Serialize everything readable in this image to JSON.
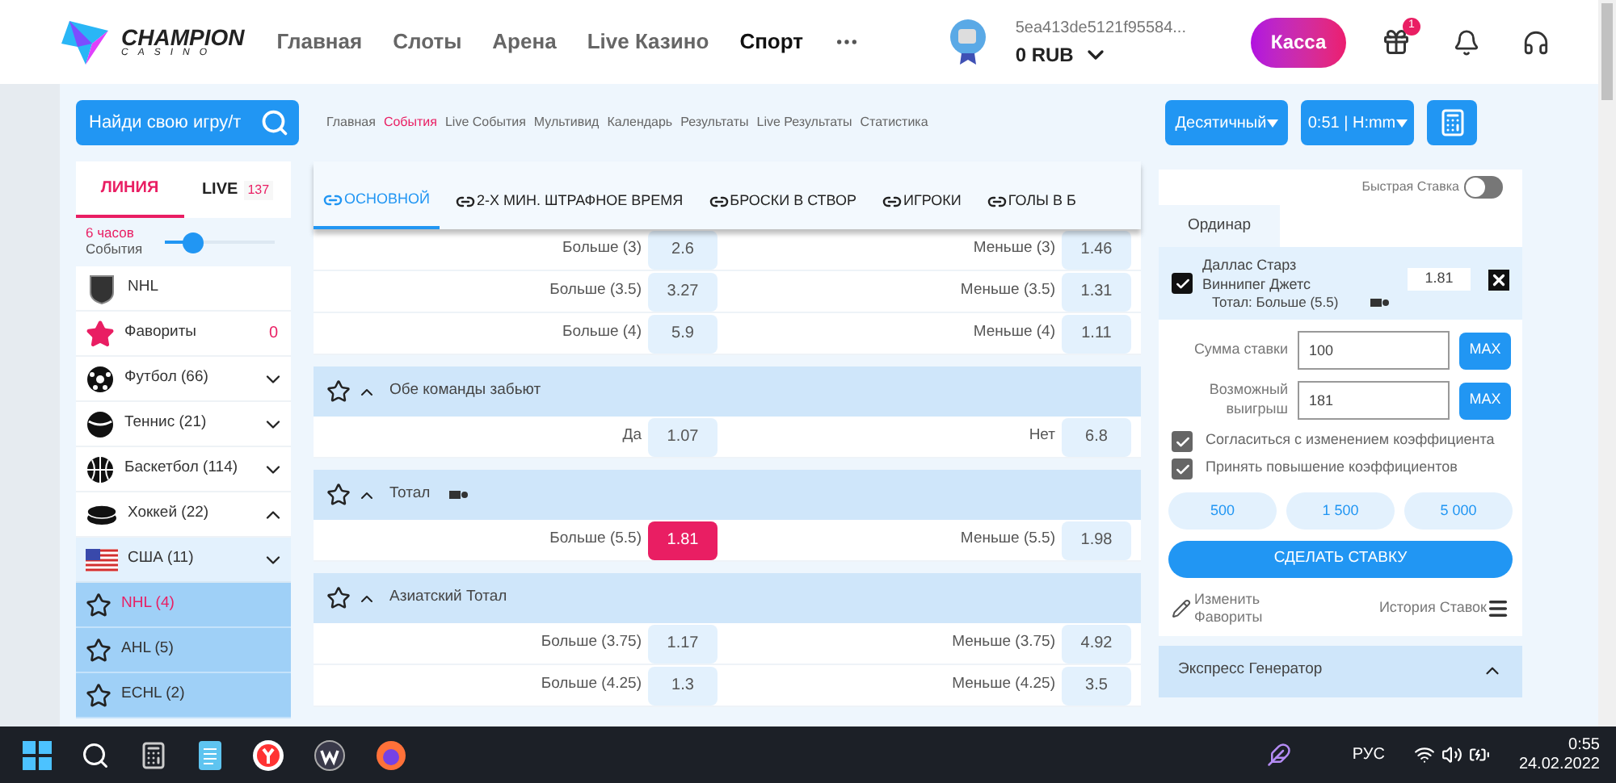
{
  "header": {
    "logo": {
      "title": "CHAMPION",
      "subtitle": "CASINO"
    },
    "nav": [
      {
        "label": "Главная",
        "selected": false
      },
      {
        "label": "Слоты",
        "selected": false
      },
      {
        "label": "Арена",
        "selected": false
      },
      {
        "label": "Live Казино",
        "selected": false
      },
      {
        "label": "Спорт",
        "selected": true
      }
    ],
    "account": {
      "id": "5ea413de5121f95584...",
      "balance": "0 RUB"
    },
    "cashier": "Касса",
    "gift_badge": "1"
  },
  "toolbar": {
    "search_placeholder": "Найди свою игру/т",
    "breadcrumbs": [
      {
        "label": "Главная",
        "selected": false
      },
      {
        "label": "События",
        "selected": true
      },
      {
        "label": "Live События",
        "selected": false
      },
      {
        "label": "Мультивид",
        "selected": false
      },
      {
        "label": "Календарь",
        "selected": false
      },
      {
        "label": "Результаты",
        "selected": false
      },
      {
        "label": "Live Результаты",
        "selected": false
      },
      {
        "label": "Статистика",
        "selected": false
      }
    ],
    "odds_format": "Десятичный",
    "time_format": "0:51 | H:mm"
  },
  "sidebar": {
    "tabs": [
      {
        "label": "ЛИНИЯ",
        "selected": true
      },
      {
        "label": "LIVE",
        "count": "137",
        "selected": false
      }
    ],
    "filter": {
      "period": "6 часов",
      "label": "События",
      "level": 0.25
    },
    "items": [
      {
        "kind": "league",
        "label": "NHL"
      },
      {
        "kind": "favorites",
        "label": "Фавориты",
        "count": "0"
      },
      {
        "kind": "football",
        "label": "Футбол (66)",
        "expanded": false
      },
      {
        "kind": "tennis",
        "label": "Теннис (21)",
        "expanded": false
      },
      {
        "kind": "basketball",
        "label": "Баскетбол (114)",
        "expanded": false
      },
      {
        "kind": "hockey",
        "label": "Хоккей (22)",
        "expanded": true,
        "children": [
          {
            "kind": "country",
            "label": "США (11)",
            "expanded": false,
            "children": [
              {
                "kind": "tournament",
                "label": "NHL (4)",
                "selected": true
              },
              {
                "kind": "tournament",
                "label": "AHL (5)",
                "selected": false
              },
              {
                "kind": "tournament",
                "label": "ECHL (2)",
                "selected": false
              }
            ]
          }
        ]
      }
    ]
  },
  "markets": {
    "tabs": [
      {
        "label": "ОСНОВНОЙ",
        "selected": true
      },
      {
        "label": "2-Х МИН. ШТРАФНОЕ ВРЕМЯ",
        "selected": false
      },
      {
        "label": "БРОСКИ В СТВОР",
        "selected": false
      },
      {
        "label": "ИГРОКИ",
        "selected": false
      },
      {
        "label": "ГОЛЫ В Б",
        "selected": false
      }
    ],
    "groups": [
      {
        "rows": [
          [
            {
              "label": "Больше (3)",
              "odd": "2.6",
              "selected": false
            },
            {
              "label": "Меньше (3)",
              "odd": "1.46",
              "selected": false
            }
          ],
          [
            {
              "label": "Больше (3.5)",
              "odd": "3.27",
              "selected": false
            },
            {
              "label": "Меньше (3.5)",
              "odd": "1.31",
              "selected": false
            }
          ],
          [
            {
              "label": "Больше (4)",
              "odd": "5.9",
              "selected": false
            },
            {
              "label": "Меньше (4)",
              "odd": "1.11",
              "selected": false
            }
          ]
        ]
      },
      {
        "title": "Обе команды забьют",
        "favorite": false,
        "expanded": true,
        "rows": [
          [
            {
              "label": "Да",
              "odd": "1.07",
              "selected": false
            },
            {
              "label": "Нет",
              "odd": "6.8",
              "selected": false
            }
          ]
        ]
      },
      {
        "title": "Тотал",
        "favorite": false,
        "expanded": true,
        "stats_icon": true,
        "rows": [
          [
            {
              "label": "Больше (5.5)",
              "odd": "1.81",
              "selected": true
            },
            {
              "label": "Меньше (5.5)",
              "odd": "1.98",
              "selected": false
            }
          ]
        ]
      },
      {
        "title": "Азиатский Тотал",
        "favorite": false,
        "expanded": true,
        "rows": [
          [
            {
              "label": "Больше (3.75)",
              "odd": "1.17",
              "selected": false
            },
            {
              "label": "Меньше (3.75)",
              "odd": "4.92",
              "selected": false
            }
          ],
          [
            {
              "label": "Больше (4.25)",
              "odd": "1.3",
              "selected": false
            },
            {
              "label": "Меньше (4.25)",
              "odd": "3.5",
              "selected": false
            }
          ]
        ]
      }
    ]
  },
  "bet_slip": {
    "quick_bet": {
      "label": "Быстрая Ставка",
      "on": false
    },
    "tabs": [
      {
        "label": "Ординар",
        "selected": true
      }
    ],
    "bet": {
      "checked": true,
      "team_home": "Даллас Старз",
      "team_away": "Виннипег Джетс",
      "odd": "1.81",
      "selection": "Тотал: Больше (5.5)"
    },
    "stake": {
      "label": "Сумма ставки",
      "value": "100",
      "max": "MAX"
    },
    "win": {
      "label": "Возможный выигрыш",
      "value": "181",
      "max": "MAX"
    },
    "options": [
      {
        "label": "Согласиться с изменением коэффициента",
        "checked": true
      },
      {
        "label": "Принять повышение коэффициентов",
        "checked": true
      }
    ],
    "amounts": [
      "500",
      "1 500",
      "5 000"
    ],
    "submit": "СДЕЛАТЬ СТАВКУ",
    "edit_favorites": "Изменить Фавориты",
    "history": "История Ставок",
    "express": {
      "label": "Экспресс Генератор",
      "expanded": true
    }
  },
  "taskbar": {
    "language": "РУС",
    "time": "0:55",
    "date": "24.02.2022"
  }
}
